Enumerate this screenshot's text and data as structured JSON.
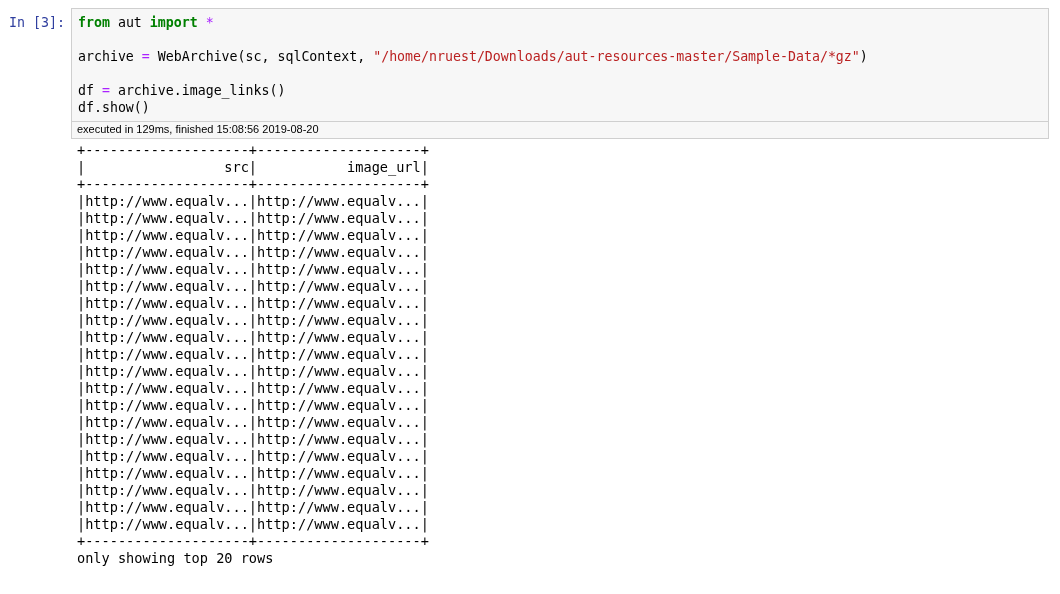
{
  "cell": {
    "prompt": "In [3]:",
    "code_blocks": [
      [
        [
          {
            "text": "from",
            "kind": "keyword"
          },
          {
            "text": " aut ",
            "kind": "plain"
          },
          {
            "text": "import",
            "kind": "keyword"
          },
          {
            "text": " *",
            "kind": "operator"
          }
        ]
      ],
      [
        [
          {
            "text": "archive ",
            "kind": "plain"
          },
          {
            "text": "=",
            "kind": "operator"
          },
          {
            "text": " WebArchive(sc, sqlContext, ",
            "kind": "plain"
          },
          {
            "text": "\"/home/nruest/Downloads/aut-resources-master/Sample-Data/*gz\"",
            "kind": "string"
          },
          {
            "text": ")",
            "kind": "plain"
          }
        ]
      ],
      [
        [
          {
            "text": "df ",
            "kind": "plain"
          },
          {
            "text": "=",
            "kind": "operator"
          },
          {
            "text": " archive.image_links()",
            "kind": "plain"
          }
        ],
        [
          {
            "text": "df.show()",
            "kind": "plain"
          }
        ]
      ]
    ],
    "execution_info": "executed in 129ms, finished 15:08:56 2019-08-20",
    "output_lines": [
      "+--------------------+--------------------+",
      "|                 src|           image_url|",
      "+--------------------+--------------------+",
      "|http://www.equalv...|http://www.equalv...|",
      "|http://www.equalv...|http://www.equalv...|",
      "|http://www.equalv...|http://www.equalv...|",
      "|http://www.equalv...|http://www.equalv...|",
      "|http://www.equalv...|http://www.equalv...|",
      "|http://www.equalv...|http://www.equalv...|",
      "|http://www.equalv...|http://www.equalv...|",
      "|http://www.equalv...|http://www.equalv...|",
      "|http://www.equalv...|http://www.equalv...|",
      "|http://www.equalv...|http://www.equalv...|",
      "|http://www.equalv...|http://www.equalv...|",
      "|http://www.equalv...|http://www.equalv...|",
      "|http://www.equalv...|http://www.equalv...|",
      "|http://www.equalv...|http://www.equalv...|",
      "|http://www.equalv...|http://www.equalv...|",
      "|http://www.equalv...|http://www.equalv...|",
      "|http://www.equalv...|http://www.equalv...|",
      "|http://www.equalv...|http://www.equalv...|",
      "|http://www.equalv...|http://www.equalv...|",
      "|http://www.equalv...|http://www.equalv...|",
      "+--------------------+--------------------+",
      "only showing top 20 rows"
    ]
  }
}
